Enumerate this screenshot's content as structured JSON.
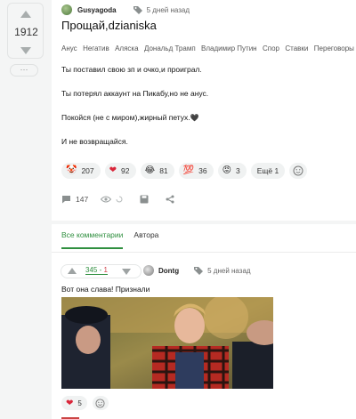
{
  "rail": {
    "rating": "1912",
    "more_label": "···"
  },
  "post": {
    "author": "Gusyagoda",
    "time": "5 дней назад",
    "title": "Прощай,dzianiska",
    "tags": [
      "Анус",
      "Негатив",
      "Аляска",
      "Дональд Трамп",
      "Владимир Путин",
      "Спор",
      "Ставки",
      "Переговоры"
    ],
    "lines": [
      "Ты поставил свою зп и очко,и проиграл.",
      "Ты потерял аккаунт на Пикабу,но не анус.",
      "Покойся (не с миром),жирный петух.",
      "И не возвращайся."
    ],
    "heart_glyph": "🖤",
    "reactions": [
      {
        "emoji": "🤡",
        "count": "207"
      },
      {
        "emoji": "❤",
        "count": "92"
      },
      {
        "emoji": "😂",
        "count": "81"
      },
      {
        "emoji": "💯",
        "count": "36"
      },
      {
        "emoji": "😡",
        "count": "3"
      }
    ],
    "more_reactions": "Ещё 1",
    "comments_count": "147"
  },
  "comments": {
    "tabs": [
      "Все комментарии",
      "Автора"
    ],
    "score_plus": "345",
    "score_sep": " - ",
    "score_minus": "1",
    "author": "Dontg",
    "time": "5 дней назад",
    "text": "Вот она слава! Признали",
    "likes": "5"
  },
  "colors": {
    "accent": "#2f8f3f",
    "minus": "#d0434b",
    "background": "#f4f5f5"
  }
}
